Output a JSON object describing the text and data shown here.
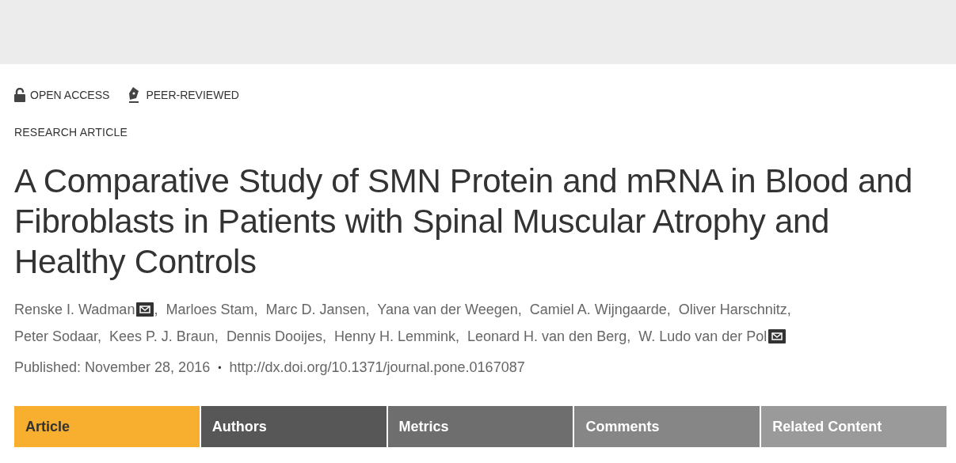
{
  "badges": [
    {
      "kind": "open",
      "label": "OPEN ACCESS"
    },
    {
      "kind": "peer",
      "label": "PEER-REVIEWED"
    }
  ],
  "article_type": "RESEARCH ARTICLE",
  "title": "A Comparative Study of SMN Protein and mRNA in Blood and Fibroblasts in Patients with Spinal Muscular Atrophy and Healthy Controls",
  "authors": [
    {
      "name": "Renske I. Wadman",
      "email": true,
      "suffix": ","
    },
    {
      "name": "Marloes Stam,",
      "email": false
    },
    {
      "name": "Marc D. Jansen,",
      "email": false
    },
    {
      "name": "Yana van der Weegen,",
      "email": false
    },
    {
      "name": "Camiel A. Wijngaarde,",
      "email": false
    },
    {
      "name": "Oliver Harschnitz,",
      "email": false
    },
    {
      "name": "Peter Sodaar,",
      "email": false
    },
    {
      "name": "Kees P. J. Braun,",
      "email": false
    },
    {
      "name": "Dennis Dooijes,",
      "email": false
    },
    {
      "name": "Henny H. Lemmink,",
      "email": false
    },
    {
      "name": "Leonard H. van den Berg,",
      "email": false
    },
    {
      "name": "W. Ludo van der Pol",
      "email": true
    }
  ],
  "published": "Published: November 28, 2016",
  "separator": "•",
  "doi": "http://dx.doi.org/10.1371/journal.pone.0167087",
  "tabs": [
    {
      "label": "Article",
      "selected": true
    },
    {
      "label": "Authors",
      "selected": false
    },
    {
      "label": "Metrics",
      "selected": false
    },
    {
      "label": "Comments",
      "selected": false
    },
    {
      "label": "Related Content",
      "selected": false
    }
  ]
}
